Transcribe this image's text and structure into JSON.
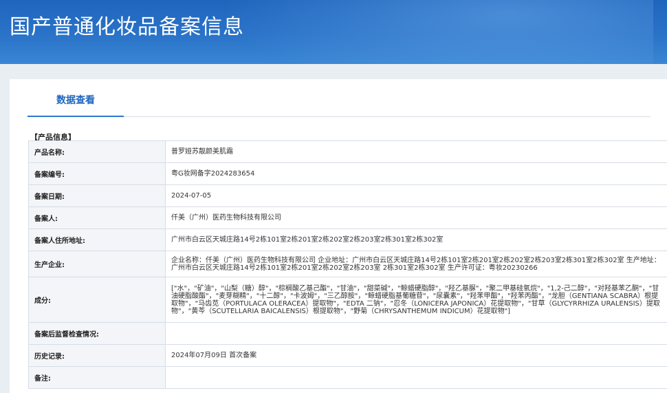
{
  "header": {
    "title": "国产普通化妆品备案信息"
  },
  "tabs": [
    {
      "label": "数据查看"
    }
  ],
  "section": {
    "label": "【产品信息】"
  },
  "rows": [
    {
      "label": "产品名称:",
      "value": "普罗娅苏靓颜美肌霜"
    },
    {
      "label": "备案编号:",
      "value": "粤G妆网备字2024283654"
    },
    {
      "label": "备案日期:",
      "value": "2024-07-05"
    },
    {
      "label": "备案人:",
      "value": "仟美（广州）医药生物科技有限公司"
    },
    {
      "label": "备案人住所地址:",
      "value": "广州市白云区天城庄路14号2栋101室2栋201室2栋202室2栋203室2栋301室2栋302室"
    },
    {
      "label": "生产企业:",
      "value": "企业名称：仟美（广州）医药生物科技有限公司 企业地址：广州市白云区天城庄路14号2栋101室2栋201室2栋202室2栋203室2栋301室2栋302室 生产地址：广州市白云区天城庄路14号2栋101室2栋201室2栋202室2栋203室 2栋301室2栋302室 生产许可证：粤妆20230266"
    },
    {
      "label": "成分:",
      "value": "[\"水\"，\"矿油\"，\"山梨（糖）醇\"，\"棕榈酸乙基己酯\"，\"甘油\"，\"甜菜碱\"，\"鲸蜡硬脂醇\"，\"羟乙基脲\"，\"聚二甲基硅氧烷\"，\"1,2-己二醇\"，\"对羟基苯乙酮\"，\"甘油硬脂酸酯\"，\"麦芽糊精\"，\"十二醇\"，\"卡波姆\"，\"三乙醇胺\"，\"鲸蜡硬脂基葡糖苷\"，\"尿囊素\"，\"羟苯甲酯\"，\"羟苯丙酯\"，\"龙胆（GENTIANA SCABRA）根提取物\"，\"马齿苋（PORTULACA OLERACEA）提取物\"，\"EDTA 二钠\"，\"忍冬（LONICERA JAPONICA）花提取物\"，\"甘草（GLYCYRRHIZA URALENSIS）提取物\"，\"黄芩（SCUTELLARIA BAICALENSIS）根提取物\"，\"野菊（CHRYSANTHEMUM INDICUM）花提取物\"]"
    },
    {
      "label": "备案后监督检查情况:",
      "value": ""
    },
    {
      "label": "历史记录:",
      "value": "2024年07月09日 首次备案"
    },
    {
      "label": "备注:",
      "value": ""
    }
  ]
}
